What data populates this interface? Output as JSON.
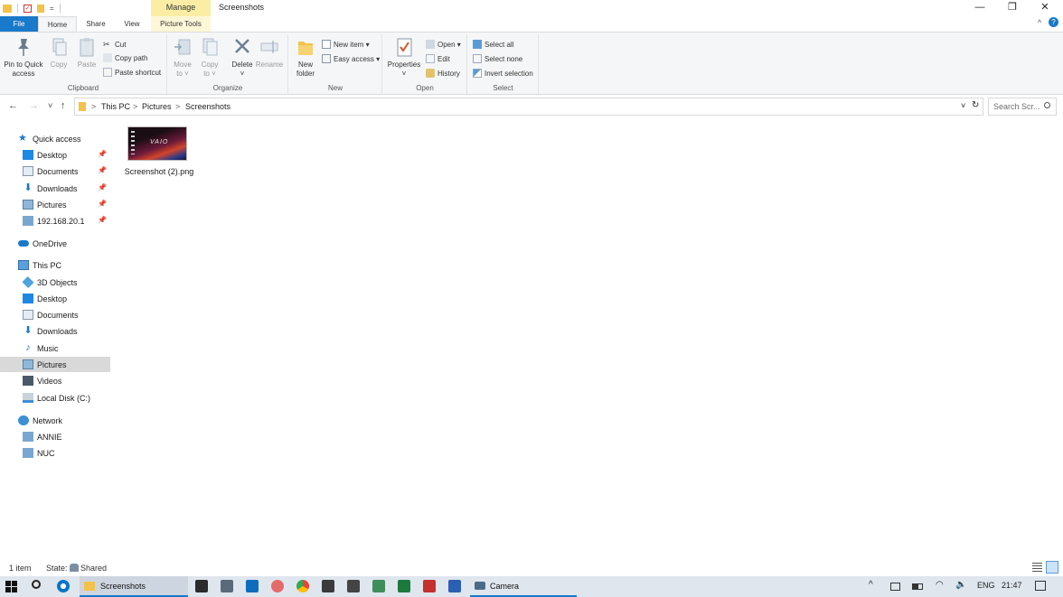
{
  "titlebar": {
    "manage_tab": "Manage",
    "window_title": "Screenshots",
    "qa_dropdown": "=",
    "minimize": "—",
    "maximize": "❐",
    "close": "✕",
    "up_chevron": "^",
    "help": "?"
  },
  "tabs": {
    "file": "File",
    "home": "Home",
    "share": "Share",
    "view": "View",
    "picture_tools": "Picture Tools"
  },
  "ribbon": {
    "clipboard": {
      "label": "Clipboard",
      "pin_line1": "Pin to Quick",
      "pin_line2": "access",
      "copy": "Copy",
      "paste": "Paste",
      "cut": "Cut",
      "copy_path": "Copy path",
      "paste_shortcut": "Paste shortcut"
    },
    "organize": {
      "label": "Organize",
      "move_line1": "Move",
      "move_line2": "to ˅",
      "copy_line1": "Copy",
      "copy_line2": "to ˅",
      "delete_line1": "Delete",
      "delete_line2": "˅",
      "rename": "Rename"
    },
    "new": {
      "label": "New",
      "new_folder_line1": "New",
      "new_folder_line2": "folder",
      "new_item": "New item ▾",
      "easy_access": "Easy access ▾"
    },
    "open": {
      "label": "Open",
      "properties_line1": "Properties",
      "properties_line2": "˅",
      "open": "Open ▾",
      "edit": "Edit",
      "history": "History"
    },
    "select": {
      "label": "Select",
      "select_all": "Select all",
      "select_none": "Select none",
      "invert_selection": "Invert selection"
    }
  },
  "address": {
    "back": "←",
    "forward": "→",
    "recent": "˅",
    "up": "↑",
    "sep": ">",
    "crumbs": [
      "This PC",
      "Pictures",
      "Screenshots"
    ],
    "dropdown": "˅",
    "refresh": "↻",
    "search_placeholder": "Search Scr..."
  },
  "navpane": {
    "quick_access": "Quick access",
    "quick_items": [
      "Desktop",
      "Documents",
      "Downloads",
      "Pictures",
      "192.168.20.1"
    ],
    "onedrive": "OneDrive",
    "this_pc": "This PC",
    "pc_items": [
      "3D Objects",
      "Desktop",
      "Documents",
      "Downloads",
      "Music",
      "Pictures",
      "Videos",
      "Local Disk (C:)"
    ],
    "network": "Network",
    "network_items": [
      "ANNIE",
      "NUC"
    ]
  },
  "content": {
    "file_name": "Screenshot (2).png",
    "thumb_logo": "VAIO"
  },
  "statusbar": {
    "items": "1 item",
    "state": "State:",
    "shared": "Shared"
  },
  "taskbar": {
    "explorer_app": "Screenshots",
    "camera_app": "Camera",
    "lang": "ENG",
    "time": "21:47"
  },
  "colors": {
    "file_tab": "#1979ca",
    "manage_tab": "#fbeea4",
    "selected_nav": "#d9d9d9",
    "taskbar": "#dfe6ee"
  }
}
